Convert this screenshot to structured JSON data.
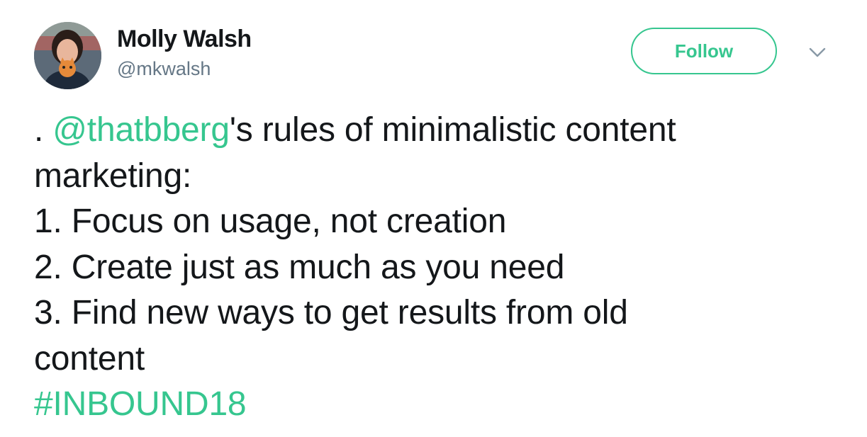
{
  "author": {
    "name": "Molly Walsh",
    "handle": "@mkwalsh"
  },
  "actions": {
    "follow_label": "Follow",
    "menu_icon": "chevron-down-icon"
  },
  "tweet": {
    "prefix": ". ",
    "mention": "@thatbberg",
    "line1_rest": "'s rules of minimalistic content",
    "line2": "marketing:",
    "line3": "1. Focus on usage, not creation",
    "line4": "2. Create just as much as you need",
    "line5": "3. Find new ways to get results from old",
    "line6": "content",
    "hashtag": "#INBOUND18"
  },
  "colors": {
    "accent": "#36c68f",
    "text": "#14171a",
    "secondary": "#657786"
  }
}
